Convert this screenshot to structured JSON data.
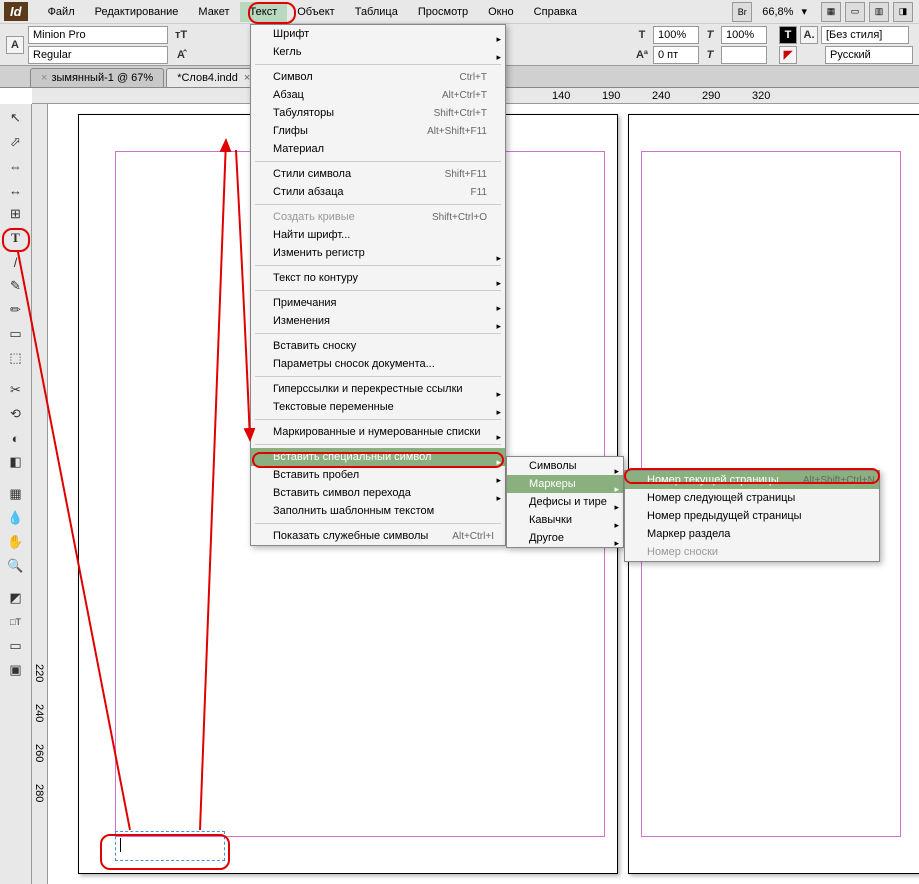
{
  "app": {
    "logo": "Id"
  },
  "menu": {
    "items": [
      "Файл",
      "Редактирование",
      "Макет",
      "Текст",
      "Объект",
      "Таблица",
      "Просмотр",
      "Окно",
      "Справка"
    ],
    "active_index": 3,
    "zoom": "66,8%"
  },
  "control": {
    "font": "Minion Pro",
    "style": "Regular",
    "scale_h": "100%",
    "scale_v": "100%",
    "baseline": "0 пт",
    "charstyle": "[Без стиля]",
    "lang": "Русский"
  },
  "tabs": [
    {
      "label": "зымянный-1 @ 67%",
      "active": false
    },
    {
      "label": "*Слов4.indd",
      "active": true
    }
  ],
  "ruler_marks": [
    "140",
    "190",
    "240",
    "290",
    "320"
  ],
  "dropdown1": {
    "groups": [
      [
        {
          "l": "Шрифт",
          "a": true
        },
        {
          "l": "Кегль",
          "a": true
        }
      ],
      [
        {
          "l": "Символ",
          "s": "Ctrl+T"
        },
        {
          "l": "Абзац",
          "s": "Alt+Ctrl+T"
        },
        {
          "l": "Табуляторы",
          "s": "Shift+Ctrl+T"
        },
        {
          "l": "Глифы",
          "s": "Alt+Shift+F11"
        },
        {
          "l": "Материал"
        }
      ],
      [
        {
          "l": "Стили символа",
          "s": "Shift+F11"
        },
        {
          "l": "Стили абзаца",
          "s": "F11"
        }
      ],
      [
        {
          "l": "Создать кривые",
          "s": "Shift+Ctrl+O",
          "d": true
        },
        {
          "l": "Найти шрифт..."
        },
        {
          "l": "Изменить регистр",
          "a": true
        }
      ],
      [
        {
          "l": "Текст по контуру",
          "a": true
        }
      ],
      [
        {
          "l": "Примечания",
          "a": true
        },
        {
          "l": "Изменения",
          "a": true
        }
      ],
      [
        {
          "l": "Вставить сноску"
        },
        {
          "l": "Параметры сносок документа..."
        }
      ],
      [
        {
          "l": "Гиперссылки и перекрестные ссылки",
          "a": true
        },
        {
          "l": "Текстовые переменные",
          "a": true
        }
      ],
      [
        {
          "l": "Маркированные и нумерованные списки",
          "a": true
        }
      ],
      [
        {
          "l": "Вставить специальный символ",
          "a": true,
          "hl": true
        },
        {
          "l": "Вставить пробел",
          "a": true
        },
        {
          "l": "Вставить символ перехода",
          "a": true
        },
        {
          "l": "Заполнить шаблонным текстом"
        }
      ],
      [
        {
          "l": "Показать служебные символы",
          "s": "Alt+Ctrl+I"
        }
      ]
    ]
  },
  "dropdown2": [
    {
      "l": "Символы",
      "a": true
    },
    {
      "l": "Маркеры",
      "a": true,
      "hl": true
    },
    {
      "l": "Дефисы и тире",
      "a": true
    },
    {
      "l": "Кавычки",
      "a": true
    },
    {
      "l": "Другое",
      "a": true
    }
  ],
  "dropdown3": [
    {
      "l": "Номер текущей страницы",
      "s": "Alt+Shift+Ctrl+N",
      "hl": true
    },
    {
      "l": "Номер следующей страницы"
    },
    {
      "l": "Номер предыдущей страницы"
    },
    {
      "l": "Маркер раздела"
    },
    {
      "l": "Номер сноски",
      "d": true
    }
  ],
  "tools": [
    "↖",
    "⬀",
    "⇔",
    "↔",
    "⊞",
    "T",
    "/",
    "✎",
    "✂",
    "▭",
    "⬚",
    "✕",
    "◐",
    "◧",
    "▦",
    "☰",
    "⊡",
    "◩",
    "✋",
    "🔍"
  ],
  "ruler_v": [
    "2",
    "2",
    "0",
    "2",
    "4",
    "0",
    "2",
    "6",
    "0",
    "2",
    "8",
    "0"
  ]
}
